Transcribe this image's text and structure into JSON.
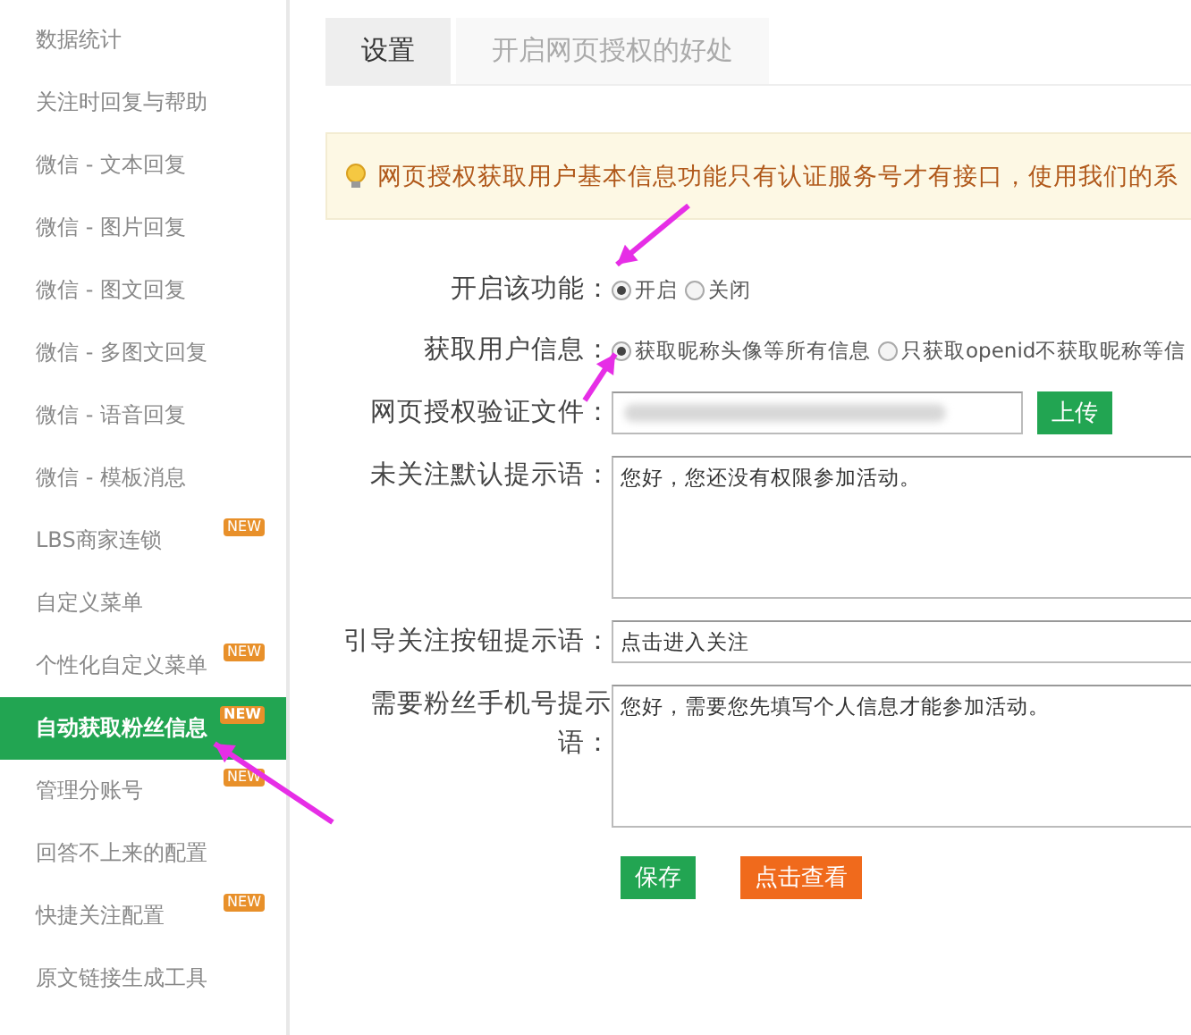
{
  "sidebar": {
    "items": [
      {
        "label": "数据统计",
        "selected": false
      },
      {
        "label": "关注时回复与帮助",
        "selected": false
      },
      {
        "label": "微信 - 文本回复",
        "selected": false
      },
      {
        "label": "微信 - 图片回复",
        "selected": false
      },
      {
        "label": "微信 - 图文回复",
        "selected": false
      },
      {
        "label": "微信 - 多图文回复",
        "selected": false
      },
      {
        "label": "微信 - 语音回复",
        "selected": false
      },
      {
        "label": "微信 - 模板消息",
        "selected": false
      },
      {
        "label": "LBS商家连锁",
        "selected": false,
        "badge": "NEW"
      },
      {
        "label": "自定义菜单",
        "selected": false
      },
      {
        "label": "个性化自定义菜单",
        "selected": false,
        "badge": "NEW"
      },
      {
        "label": "自动获取粉丝信息",
        "selected": true,
        "badge": "NEW"
      },
      {
        "label": "管理分账号",
        "selected": false,
        "badge": "NEW"
      },
      {
        "label": "回答不上来的配置",
        "selected": false
      },
      {
        "label": "快捷关注配置",
        "selected": false,
        "badge": "NEW"
      },
      {
        "label": "原文链接生成工具",
        "selected": false
      }
    ]
  },
  "tabs": [
    {
      "label": "设置",
      "selected": true
    },
    {
      "label": "开启网页授权的好处",
      "selected": false
    }
  ],
  "notice": "网页授权获取用户基本信息功能只有认证服务号才有接口，使用我们的系",
  "form": [
    {
      "kind": "radio",
      "label": "开启该功能：",
      "options": [
        {
          "label": "开启",
          "selected": true
        },
        {
          "label": "关闭",
          "selected": false
        }
      ]
    },
    {
      "kind": "radio",
      "label": "获取用户信息：",
      "options": [
        {
          "label": "获取昵称头像等所有信息",
          "selected": true
        },
        {
          "label": "只获取openid不获取昵称等信",
          "selected": false
        }
      ]
    },
    {
      "kind": "file",
      "label": "网页授权验证文件：",
      "button": "上传"
    },
    {
      "kind": "textarea",
      "label": "未关注默认提示语：",
      "value": "您好，您还没有权限参加活动。"
    },
    {
      "kind": "input",
      "label": "引导关注按钮提示语：",
      "value": "点击进入关注"
    },
    {
      "kind": "textarea",
      "label": "需要粉丝手机号提示语：",
      "value": "您好，需要您先填写个人信息才能参加活动。"
    }
  ],
  "actions": [
    {
      "label": "保存",
      "kind": "primary"
    },
    {
      "label": "点击查看",
      "kind": "warning"
    }
  ]
}
